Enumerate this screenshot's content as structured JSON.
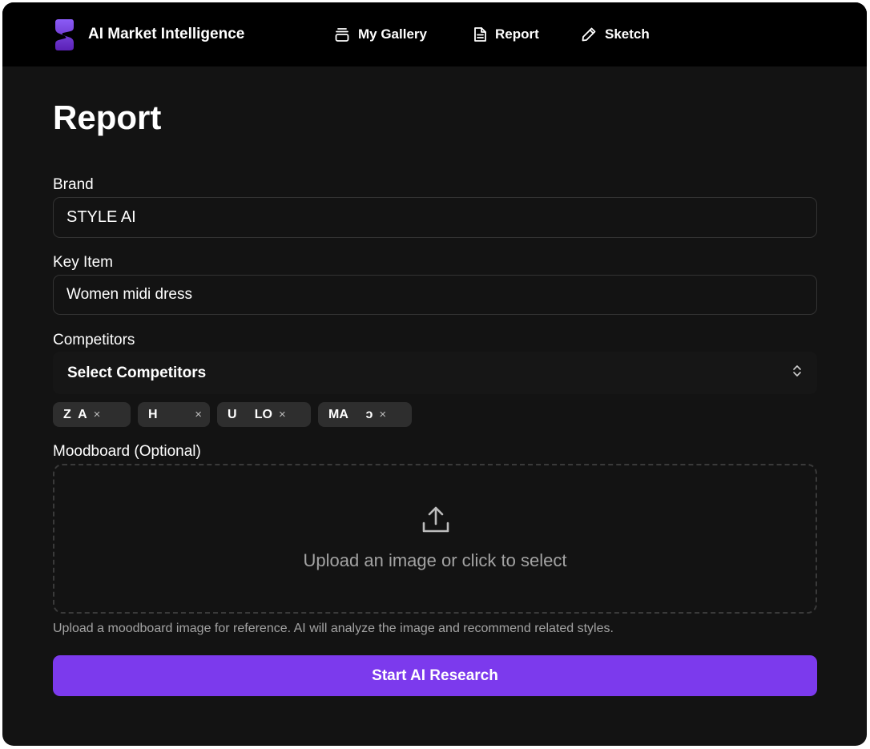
{
  "colors": {
    "background": "#131313",
    "topbar": "#000000",
    "accent": "#7c3aed",
    "chip": "#2e2e2e",
    "muted_text": "#a3a3a3"
  },
  "header": {
    "logo_icon": "brand-s-logo-icon",
    "app_title": "AI Market Intelligence",
    "nav": [
      {
        "label": "My Gallery",
        "icon": "stack-icon"
      },
      {
        "label": "Report",
        "icon": "document-icon"
      },
      {
        "label": "Sketch",
        "icon": "pencil-icon"
      }
    ]
  },
  "page": {
    "title": "Report"
  },
  "form": {
    "brand": {
      "label": "Brand",
      "value": "STYLE AI"
    },
    "key_item": {
      "label": "Key Item",
      "value": "Women midi dress"
    },
    "competitors": {
      "label": "Competitors",
      "placeholder": "Select Competitors",
      "icon": "chevron-up-down-icon",
      "selected": [
        {
          "label": "Z  A",
          "remove_icon": "×"
        },
        {
          "label": "H     ",
          "remove_icon": "×"
        },
        {
          "label": "U     LO",
          "remove_icon": "×"
        },
        {
          "label": "MA     ɔ",
          "remove_icon": "×"
        }
      ]
    },
    "moodboard": {
      "label": "Moodboard (Optional)",
      "dropzone_text": "Upload an image or click to select",
      "icon": "upload-icon",
      "hint": "Upload a moodboard image for reference. AI will analyze the image and recommend related styles."
    },
    "submit_label": "Start AI Research"
  }
}
